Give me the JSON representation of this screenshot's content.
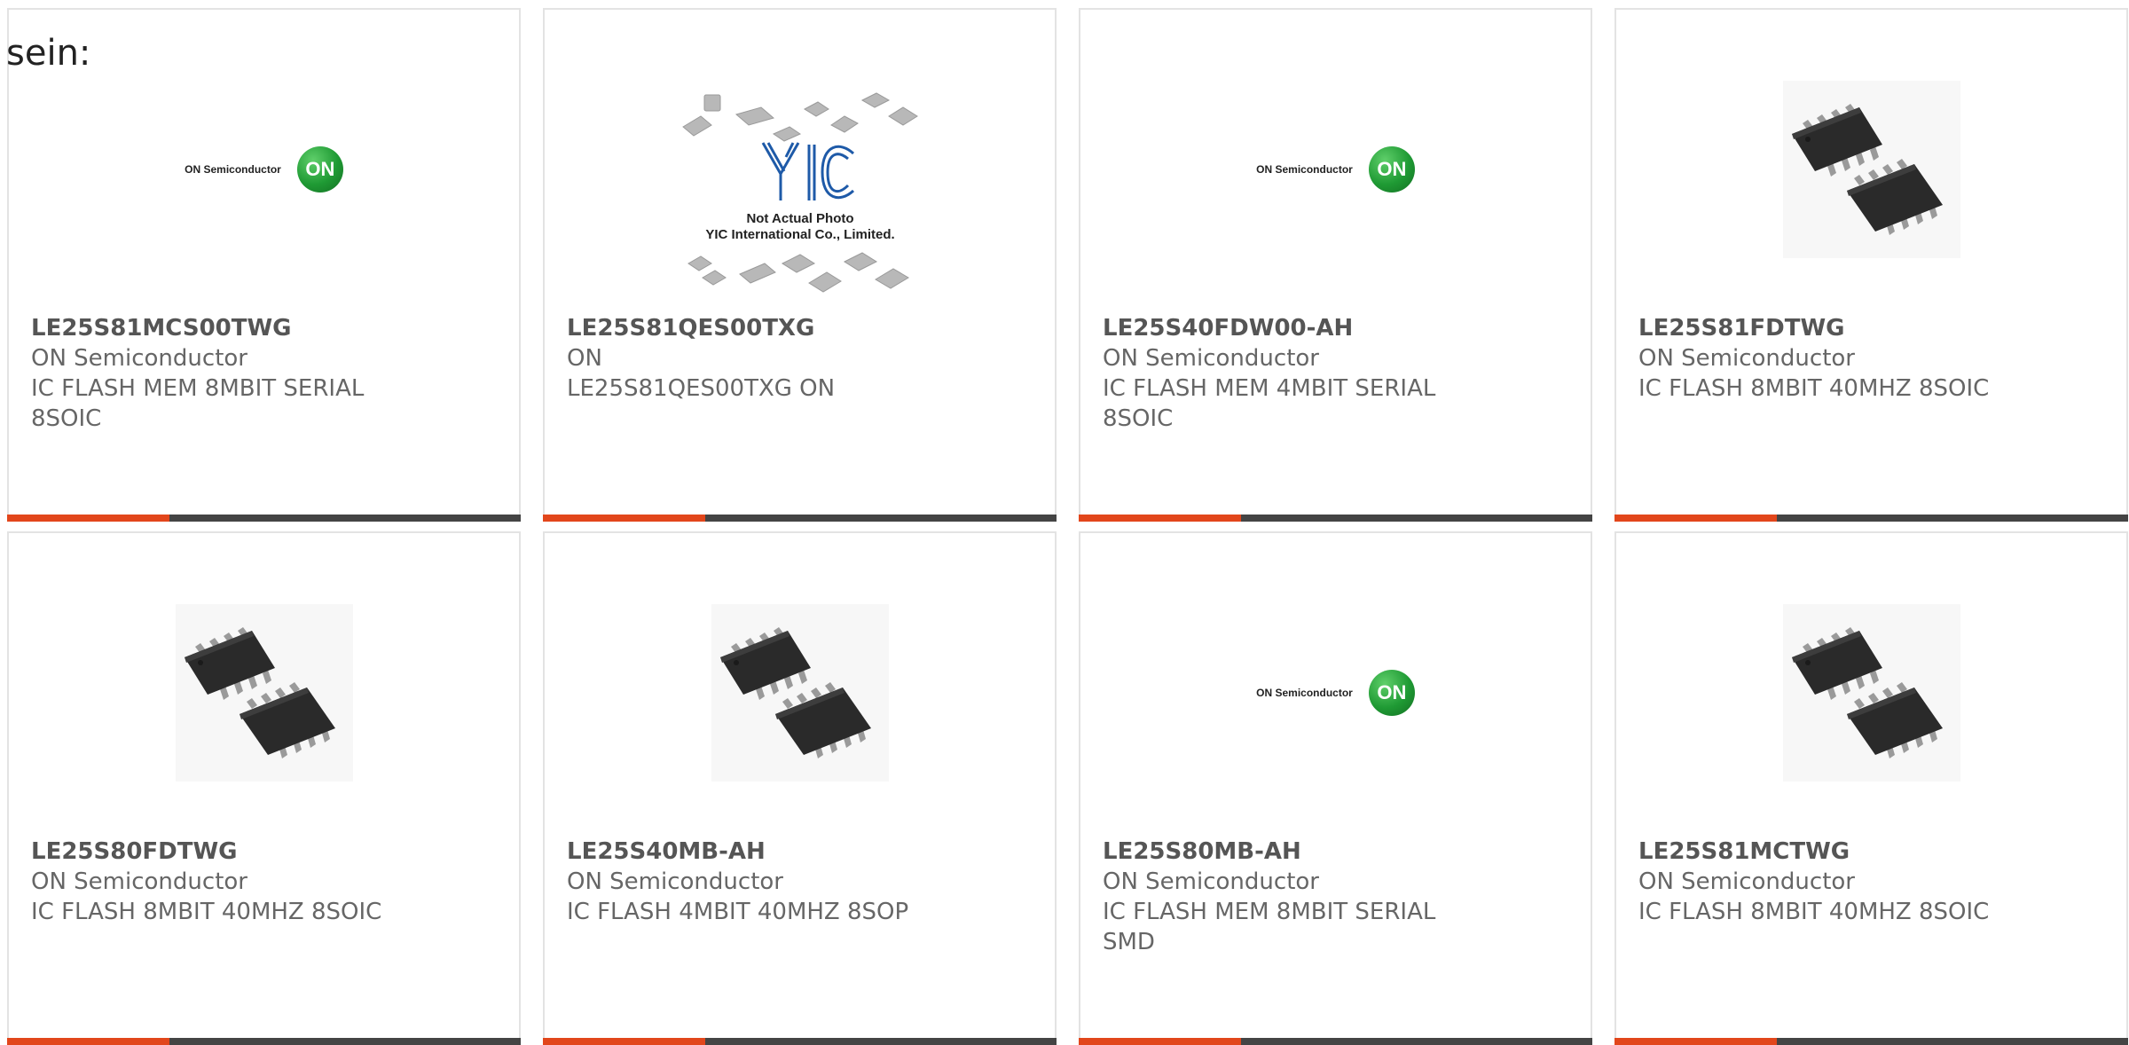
{
  "heading": "sein:",
  "brand_colors": {
    "accent": "#e2461b",
    "bar": "#444444",
    "card_border": "#e3e3e3"
  },
  "products": [
    {
      "part": "LE25S81MCS00TWG",
      "manufacturer": "ON Semiconductor",
      "desc1": "IC FLASH MEM 8MBIT SERIAL",
      "desc2": "8SOIC",
      "image": "on-semi-logo",
      "logo_text": "ON Semiconductor",
      "logo_badge": "ON"
    },
    {
      "part": "LE25S81QES00TXG",
      "manufacturer": "ON",
      "desc1": "LE25S81QES00TXG ON",
      "desc2": "",
      "image": "yic-placeholder",
      "yic_line1": "Not Actual Photo",
      "yic_line2": "YIC International Co., Limited."
    },
    {
      "part": "LE25S40FDW00-AH",
      "manufacturer": "ON Semiconductor",
      "desc1": "IC FLASH MEM 4MBIT SERIAL",
      "desc2": "8SOIC",
      "image": "on-semi-logo",
      "logo_text": "ON Semiconductor",
      "logo_badge": "ON"
    },
    {
      "part": "LE25S81FDTWG",
      "manufacturer": "ON Semiconductor",
      "desc1": "IC FLASH 8MBIT 40MHZ 8SOIC",
      "desc2": "",
      "image": "soic-chip-photo"
    },
    {
      "part": "LE25S80FDTWG",
      "manufacturer": "ON Semiconductor",
      "desc1": "IC FLASH 8MBIT 40MHZ 8SOIC",
      "desc2": "",
      "image": "soic-chip-photo"
    },
    {
      "part": "LE25S40MB-AH",
      "manufacturer": "ON Semiconductor",
      "desc1": "IC FLASH 4MBIT 40MHZ 8SOP",
      "desc2": "",
      "image": "soic-chip-photo"
    },
    {
      "part": "LE25S80MB-AH",
      "manufacturer": "ON Semiconductor",
      "desc1": "IC FLASH MEM 8MBIT SERIAL",
      "desc2": "SMD",
      "image": "on-semi-logo",
      "logo_text": "ON Semiconductor",
      "logo_badge": "ON"
    },
    {
      "part": "LE25S81MCTWG",
      "manufacturer": "ON Semiconductor",
      "desc1": "IC FLASH 8MBIT 40MHZ 8SOIC",
      "desc2": "",
      "image": "soic-chip-photo"
    }
  ]
}
